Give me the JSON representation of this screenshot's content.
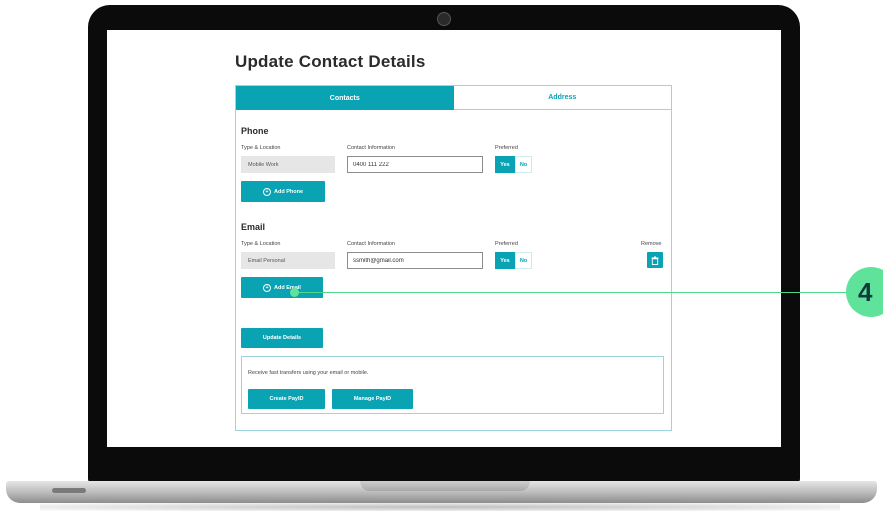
{
  "page": {
    "title": "Update Contact Details"
  },
  "tabs": [
    {
      "label": "Contacts",
      "active": true
    },
    {
      "label": "Address",
      "active": false
    }
  ],
  "phone": {
    "section_title": "Phone",
    "col_type": "Type & Location",
    "col_contact": "Contact Information",
    "col_preferred": "Preferred",
    "type_value": "Mobile Work",
    "contact_value": "0400 111 222",
    "preferred": {
      "yes": "Yes",
      "no": "No",
      "selected": "Yes"
    },
    "add_button": "Add Phone"
  },
  "email": {
    "section_title": "Email",
    "col_type": "Type & Location",
    "col_contact": "Contact Information",
    "col_preferred": "Preferred",
    "col_remove": "Remove",
    "type_value": "Email Personal",
    "contact_value": "ssmith@gmail.com",
    "preferred": {
      "yes": "Yes",
      "no": "No",
      "selected": "Yes"
    },
    "add_button": "Add Email"
  },
  "update_button": "Update Details",
  "payid": {
    "text": "Receive fast transfers using your email or mobile.",
    "create_button": "Create PayID",
    "manage_button": "Manage PayID"
  },
  "callout": {
    "number": "4"
  },
  "colors": {
    "accent": "#0aa3b4",
    "callout": "#5fe39a",
    "border": "#9fd3da"
  },
  "icons": [
    "camera-icon",
    "plus-circle-icon",
    "trash-icon"
  ]
}
